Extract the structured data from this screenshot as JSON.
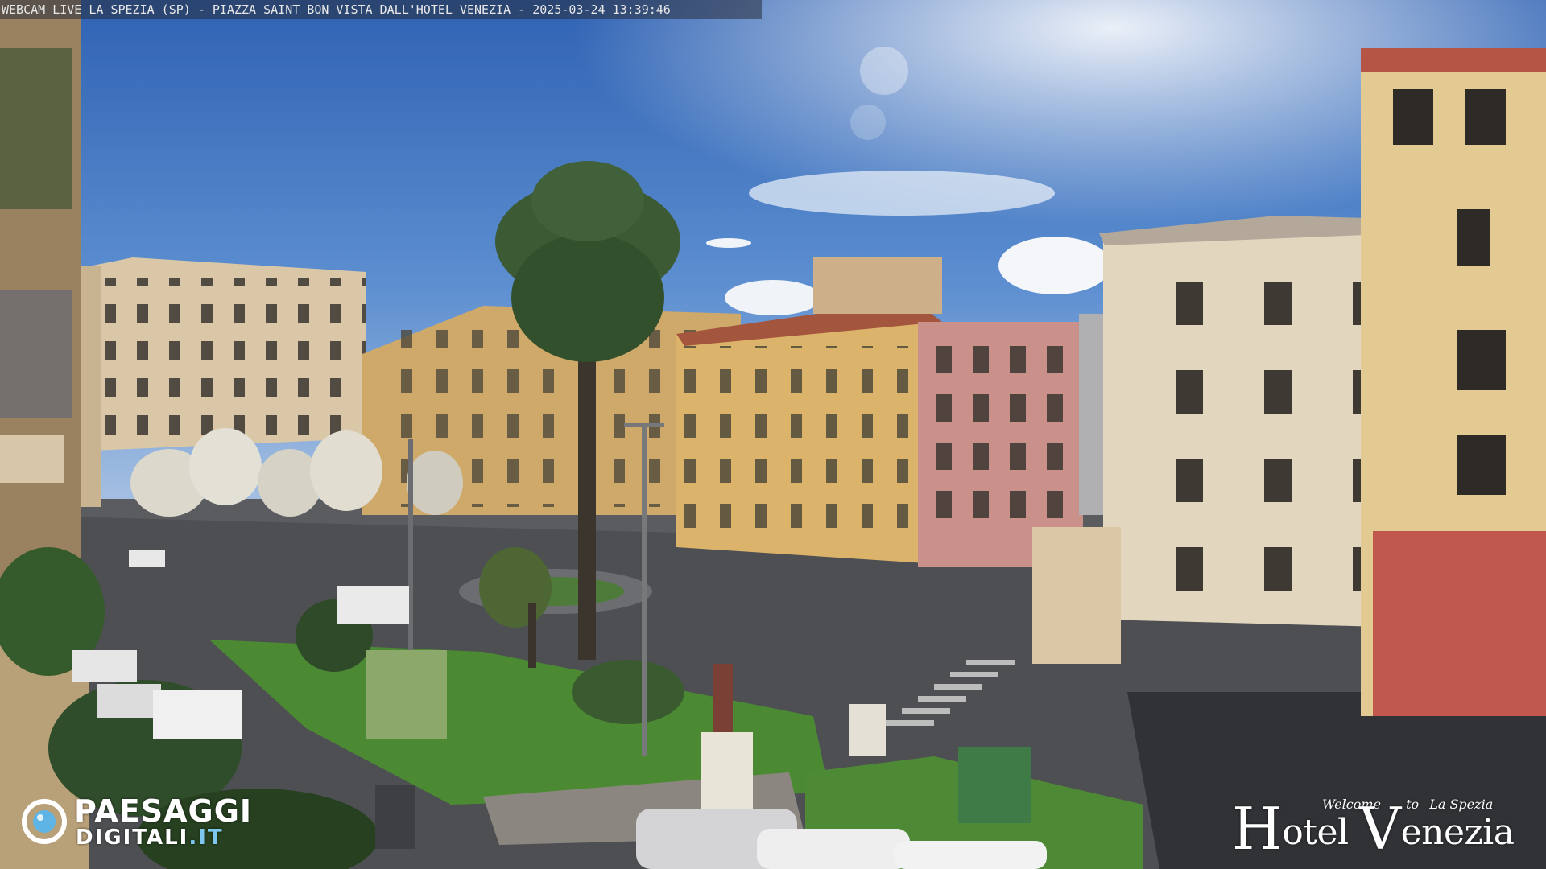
{
  "caption": "WEBCAM LIVE LA SPEZIA (SP) - PIAZZA SAINT BON VISTA DALL'HOTEL VENEZIA - 2025-03-24 13:39:46",
  "logo_left": {
    "line1": "PAESAGGI",
    "line2_main": "DIGITALI",
    "line2_accent": ".IT"
  },
  "logo_right": {
    "welcome": "Welcome",
    "to": "to",
    "city": "La Spezia",
    "cap1": "H",
    "word1": "otel ",
    "cap2": "V",
    "word2": "enezia"
  }
}
